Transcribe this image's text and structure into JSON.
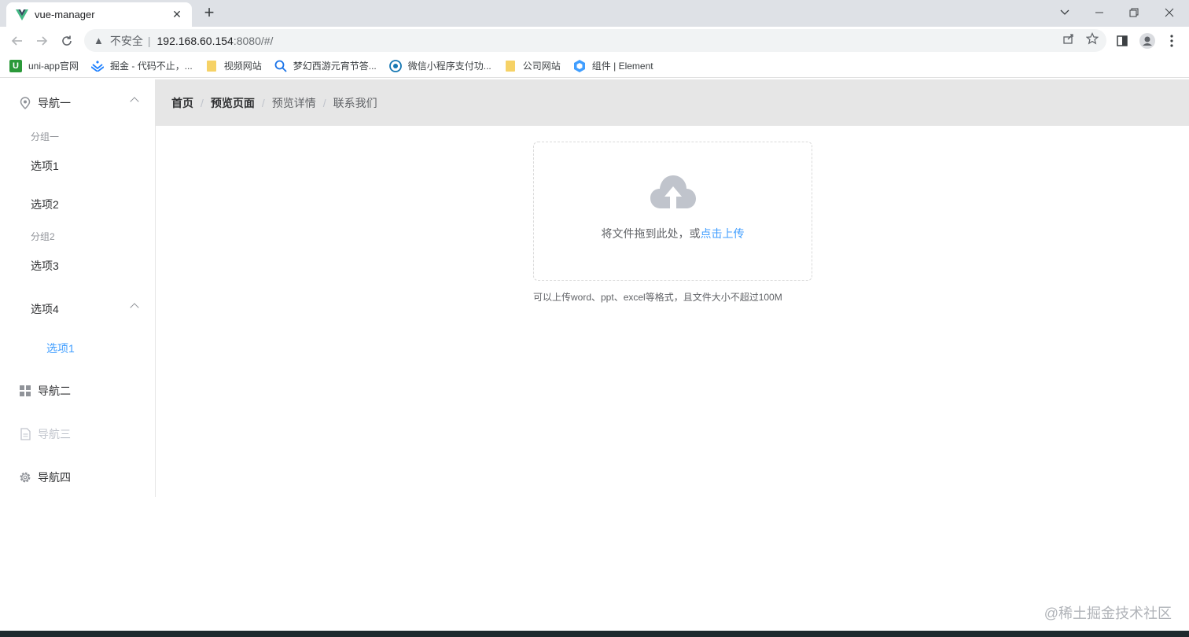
{
  "browser": {
    "tab_title": "vue-manager",
    "tab_close": "✕",
    "new_tab": "+",
    "omnibox": {
      "insecure_label": "不安全",
      "separator": "|",
      "host": "192.168.60.154",
      "path": ":8080/#/"
    },
    "bookmarks": [
      {
        "label": "uni-app官网",
        "icon": "uniapp-icon",
        "color": "#2b9939"
      },
      {
        "label": "掘金 - 代码不止，...",
        "icon": "juejin-icon",
        "color": "#1e80ff"
      },
      {
        "label": "视频网站",
        "icon": "folder-icon",
        "color": "#f6d266"
      },
      {
        "label": "梦幻西游元宵节答...",
        "icon": "search-icon",
        "color": "#1a73e8"
      },
      {
        "label": "微信小程序支付功...",
        "icon": "wechat-doc-icon",
        "color": "#1677b3"
      },
      {
        "label": "公司网站",
        "icon": "folder-icon",
        "color": "#f6d266"
      },
      {
        "label": "组件 | Element",
        "icon": "element-icon",
        "color": "#409eff"
      }
    ]
  },
  "sidebar": {
    "nav1": {
      "label": "导航一",
      "icon": "location-icon"
    },
    "group1": "分组一",
    "item1": "选项1",
    "item2": "选项2",
    "group2": "分组2",
    "item3": "选项3",
    "item4": "选项4",
    "item4_sub1": "选项1",
    "nav2": {
      "label": "导航二",
      "icon": "menu-grid-icon"
    },
    "nav3": {
      "label": "导航三",
      "icon": "document-icon"
    },
    "nav4": {
      "label": "导航四",
      "icon": "setting-icon"
    }
  },
  "breadcrumb": [
    "首页",
    "预览页面",
    "预览详情",
    "联系我们"
  ],
  "breadcrumb_separator": "/",
  "upload": {
    "text": "将文件拖到此处，或",
    "link": "点击上传",
    "tip": "可以上传word、ppt、excel等格式，且文件大小不超过100M"
  },
  "watermark": "@稀土掘金技术社区",
  "colors": {
    "primary": "#409eff",
    "breadcrumb_bg": "#e6e6e6",
    "disabled": "#c0c4cc"
  }
}
